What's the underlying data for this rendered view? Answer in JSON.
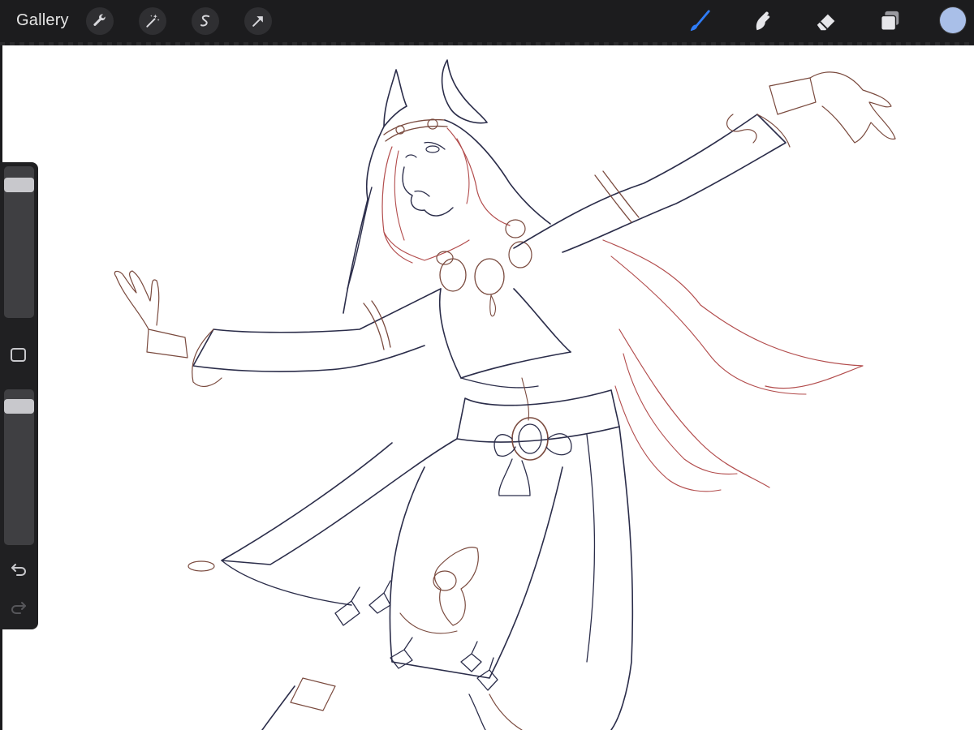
{
  "toolbar": {
    "gallery_label": "Gallery",
    "left_tools": [
      "wrench-icon",
      "magic-wand-icon",
      "selection-icon",
      "transform-arrow-icon"
    ],
    "right_tools": [
      "brush-icon",
      "smudge-icon",
      "eraser-icon",
      "layers-icon"
    ],
    "active_tool": "brush-icon",
    "active_color": "#a9bfe8",
    "accent_color": "#2f7cf6"
  },
  "sidebar": {
    "brush_size": 0.92,
    "opacity": 0.93,
    "modifier_icon": "square-modifier-icon",
    "undo_icon": "undo-icon",
    "redo_icon": "redo-icon"
  },
  "canvas": {
    "background": "#ffffff",
    "line_colors": [
      "#2b2d4a",
      "#b24c4c",
      "#7a4a3e"
    ]
  }
}
